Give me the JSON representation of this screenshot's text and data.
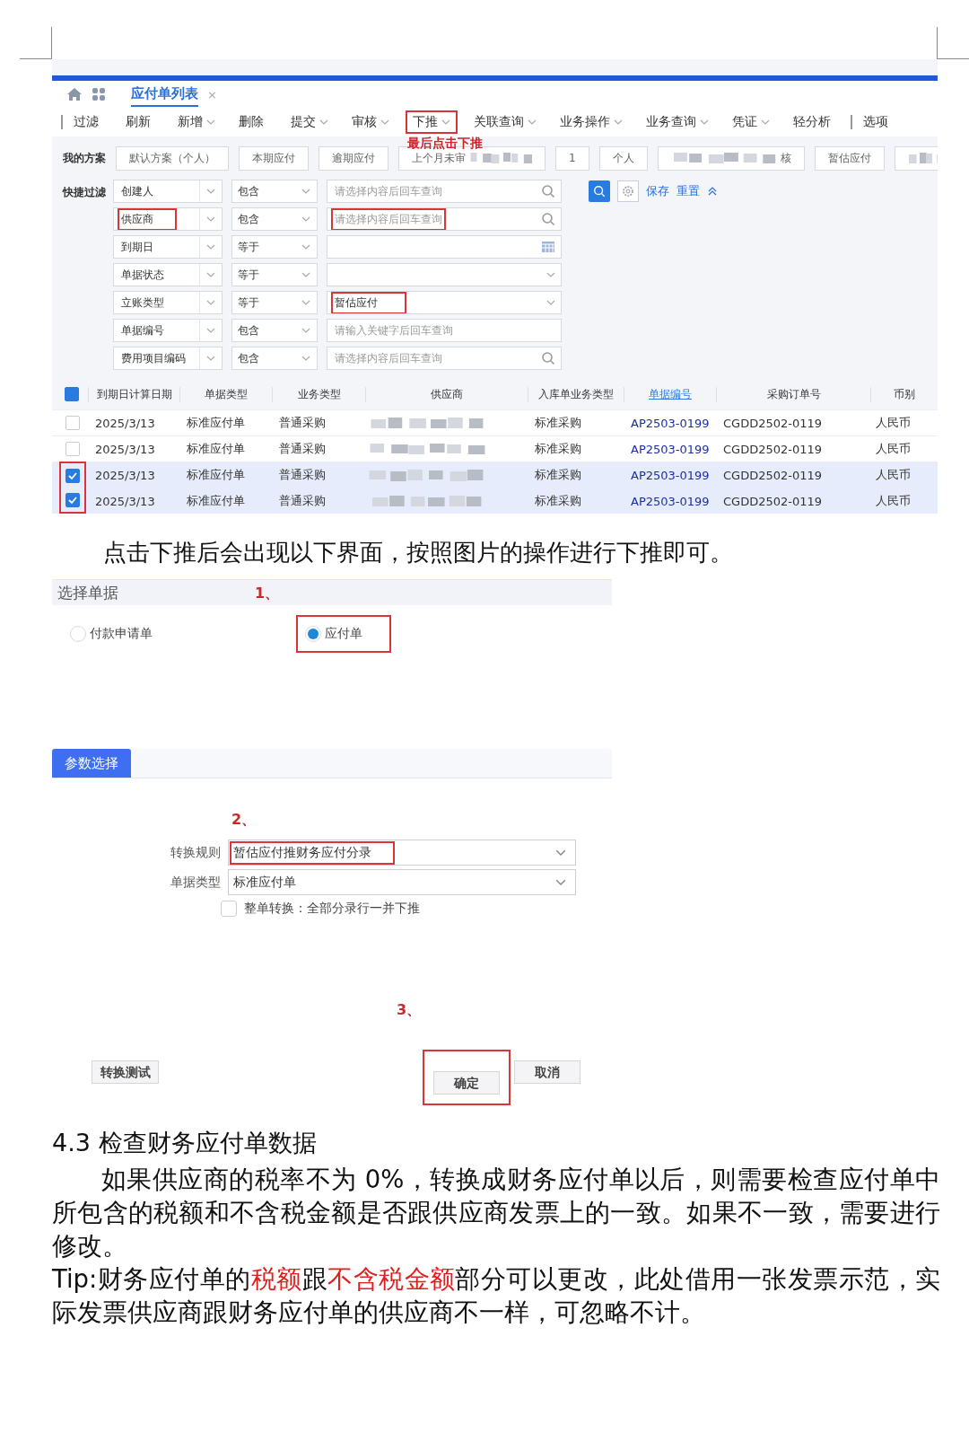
{
  "list_screenshot": {
    "tab": {
      "label": "应付单列表",
      "close": "×",
      "selected": true
    },
    "toolbar": [
      {
        "label": "过滤",
        "dropdown": false,
        "separator": true,
        "highlighted": false
      },
      {
        "label": "刷新",
        "dropdown": false,
        "separator": false,
        "highlighted": false
      },
      {
        "label": "新增",
        "dropdown": true,
        "separator": false,
        "highlighted": false
      },
      {
        "label": "删除",
        "dropdown": false,
        "separator": false,
        "highlighted": false
      },
      {
        "label": "提交",
        "dropdown": true,
        "separator": false,
        "highlighted": false
      },
      {
        "label": "审核",
        "dropdown": true,
        "separator": false,
        "highlighted": false
      },
      {
        "label": "下推",
        "dropdown": true,
        "separator": false,
        "highlighted": true,
        "note": "最后点击下推"
      },
      {
        "label": "关联查询",
        "dropdown": true,
        "separator": false,
        "highlighted": false
      },
      {
        "label": "业务操作",
        "dropdown": true,
        "separator": false,
        "highlighted": false
      },
      {
        "label": "业务查询",
        "dropdown": true,
        "separator": false,
        "highlighted": false
      },
      {
        "label": "凭证",
        "dropdown": true,
        "separator": false,
        "highlighted": false
      },
      {
        "label": "轻分析",
        "dropdown": false,
        "separator": false,
        "highlighted": false
      },
      {
        "label": "选项",
        "dropdown": false,
        "separator": true,
        "highlighted": false
      }
    ],
    "scheme_label": "我的方案",
    "schemes": [
      {
        "kind": "chip",
        "label": "默认方案（个人）"
      },
      {
        "kind": "chip",
        "label": "本期应付"
      },
      {
        "kind": "chip",
        "label": "逾期应付"
      },
      {
        "kind": "partly_blurred",
        "label": "上个月未审"
      },
      {
        "kind": "chip",
        "label": "1"
      },
      {
        "kind": "chip",
        "label": "个人"
      },
      {
        "kind": "blurred_end",
        "label": "核"
      },
      {
        "kind": "chip",
        "label": "暂估应付"
      },
      {
        "kind": "blurred"
      }
    ],
    "filter_label": "快捷过滤",
    "filters": [
      {
        "field": "创建人",
        "field_highlighted": false,
        "operator": "包含",
        "kind": "search",
        "placeholder": "请选择内容后回车查询",
        "value_highlighted": false
      },
      {
        "field": "供应商",
        "field_highlighted": true,
        "operator": "包含",
        "kind": "search",
        "placeholder": "请选择内容后回车查询",
        "value_highlighted": true
      },
      {
        "field": "到期日",
        "field_highlighted": false,
        "operator": "等于",
        "kind": "calendar",
        "value_highlighted": false
      },
      {
        "field": "单据状态",
        "field_highlighted": false,
        "operator": "等于",
        "kind": "caret",
        "value_highlighted": false
      },
      {
        "field": "立账类型",
        "field_highlighted": false,
        "operator": "等于",
        "kind": "caret",
        "value": "暂估应付",
        "value_highlighted": true
      },
      {
        "field": "单据编号",
        "field_highlighted": false,
        "operator": "包含",
        "kind": "plain",
        "placeholder": "请输入关键字后回车查询",
        "value_highlighted": false
      },
      {
        "field": "费用项目编码",
        "field_highlighted": false,
        "operator": "包含",
        "kind": "search",
        "placeholder": "请选择内容后回车查询",
        "value_highlighted": false
      }
    ],
    "save": "保存",
    "reset": "重置",
    "select_all_indeterminate": true,
    "columns": [
      {
        "label": "到期日计算日期",
        "link": false
      },
      {
        "label": "单据类型",
        "link": false
      },
      {
        "label": "业务类型",
        "link": false
      },
      {
        "label": "供应商",
        "link": false
      },
      {
        "label": "入库单业务类型",
        "link": false
      },
      {
        "label": "单据编号",
        "link": true
      },
      {
        "label": "采购订单号",
        "link": false
      },
      {
        "label": "币别",
        "link": false
      }
    ],
    "rows": [
      {
        "selected": false,
        "highlighted": false,
        "due_date": "2025/3/13",
        "doc_type": "标准应付单",
        "biz_type": "普通采购",
        "inbound_type": "标准采购",
        "doc_no": "AP2503-0199",
        "po_no": "CGDD2502-0119",
        "currency": "人民币"
      },
      {
        "selected": false,
        "highlighted": false,
        "due_date": "2025/3/13",
        "doc_type": "标准应付单",
        "biz_type": "普通采购",
        "inbound_type": "标准采购",
        "doc_no": "AP2503-0199",
        "po_no": "CGDD2502-0119",
        "currency": "人民币"
      },
      {
        "selected": true,
        "highlighted": true,
        "due_date": "2025/3/13",
        "doc_type": "标准应付单",
        "biz_type": "普通采购",
        "inbound_type": "标准采购",
        "doc_no": "AP2503-0199",
        "po_no": "CGDD2502-0119",
        "currency": "人民币"
      },
      {
        "selected": true,
        "highlighted": true,
        "due_date": "2025/3/13",
        "doc_type": "标准应付单",
        "biz_type": "普通采购",
        "inbound_type": "标准采购",
        "doc_no": "AP2503-0199",
        "po_no": "CGDD2502-0119",
        "currency": "人民币"
      }
    ]
  },
  "instruction": "点击下推后会出现以下界面，按照图片的操作进行下推即可。",
  "push_screenshot": {
    "section_title": "选择单据",
    "step1": "1、",
    "radios": [
      {
        "label": "付款申请单",
        "selected": false,
        "highlighted": false
      },
      {
        "label": "应付单",
        "selected": true,
        "highlighted": true
      }
    ],
    "param_tab": "参数选择",
    "step2": "2、",
    "params": [
      {
        "label": "转换规则",
        "value": "暂估应付推财务应付分录",
        "highlighted": true
      },
      {
        "label": "单据类型",
        "value": "标准应付单",
        "highlighted": false
      }
    ],
    "whole_convert": {
      "label": "整单转换：全部分录行一并下推",
      "checked": false
    },
    "step3": "3、",
    "buttons": [
      {
        "kind": "left",
        "label": "转换测试",
        "highlighted": false
      },
      {
        "kind": "right",
        "label": "确定",
        "highlighted": true
      },
      {
        "kind": "right",
        "label": "取消",
        "highlighted": false
      }
    ]
  },
  "heading": "4.3 检查财务应付单数据",
  "body": "如果供应商的税率不为 0%，转换成财务应付单以后，则需要检查应付单中所包含的税额和不含税金额是否跟供应商发票上的一致。如果不一致，需要进行修改。",
  "tip": "Tip:财务应付单的**税额**跟**不含税金额**部分可以更改，此处借用一张发票示范，实际发票供应商跟财务应付单的供应商不一样，可忽略不计。"
}
